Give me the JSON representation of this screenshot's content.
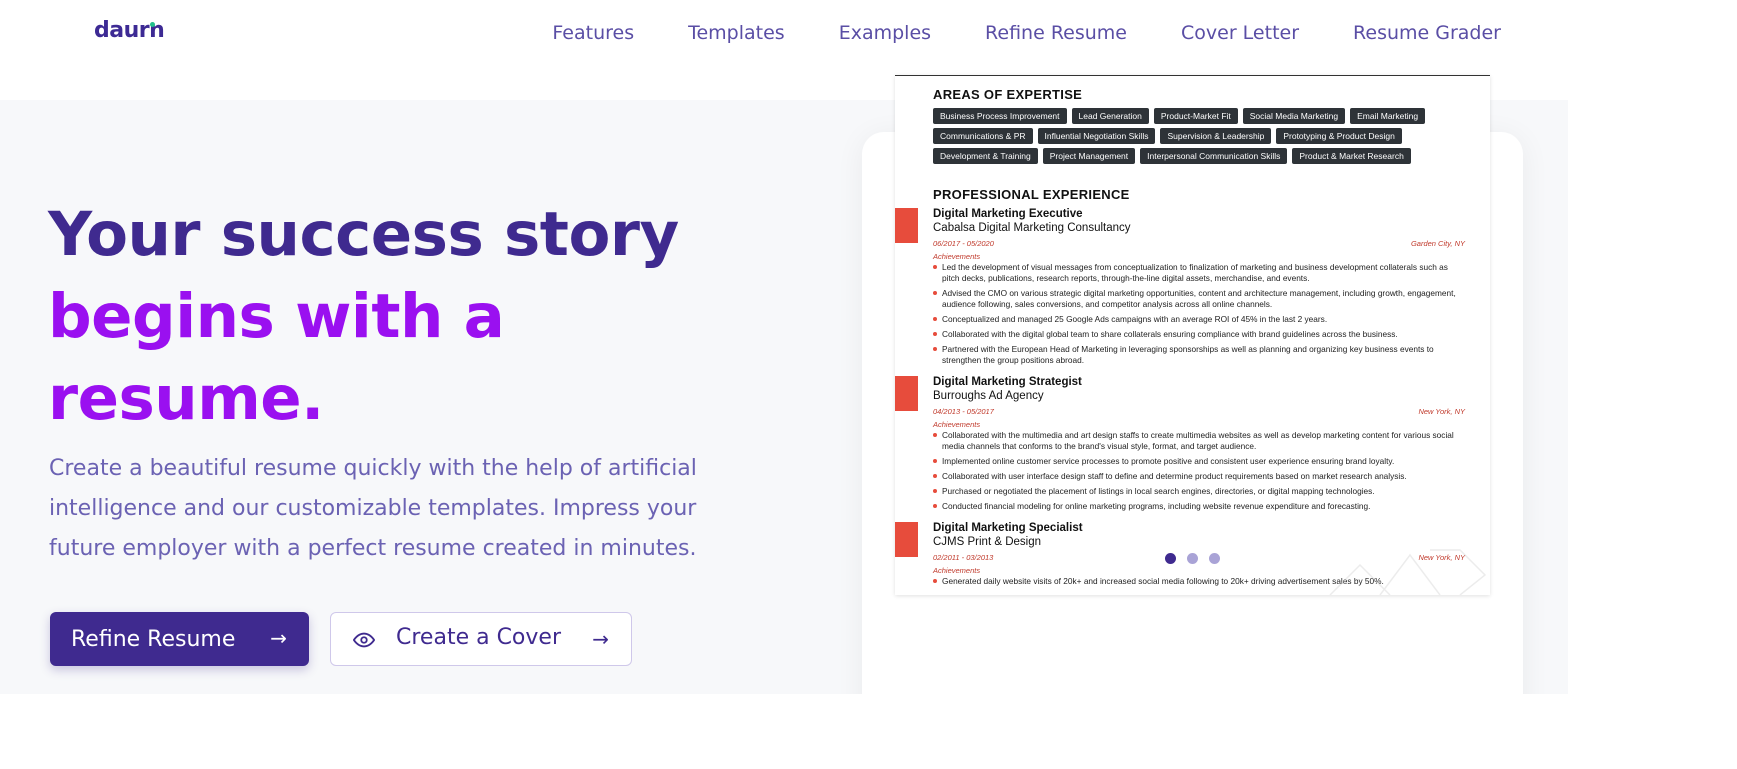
{
  "header": {
    "logo_text": "daurn",
    "nav": [
      {
        "label": "Features"
      },
      {
        "label": "Templates"
      },
      {
        "label": "Examples"
      },
      {
        "label": "Refine Resume"
      },
      {
        "label": "Cover Letter"
      },
      {
        "label": "Resume Grader"
      }
    ]
  },
  "hero": {
    "headline_line1": "Your success story",
    "headline_line2": "begins with a",
    "headline_line3": "resume.",
    "subtext": "Create a beautiful resume quickly with the help of artificial intelligence and our customizable templates. Impress your future employer with a perfect resume created in minutes.",
    "primary_button": "Refine Resume",
    "secondary_button": "Create a Cover"
  },
  "colors": {
    "brand_dark": "#3f2a8f",
    "brand_purple": "#9a10f0",
    "accent_red": "#e74c3c"
  },
  "resume": {
    "expertise_title": "AREAS OF EXPERTISE",
    "tags": [
      "Business Process Improvement",
      "Lead Generation",
      "Product-Market Fit",
      "Social Media Marketing",
      "Email Marketing",
      "Communications & PR",
      "Influential Negotiation Skills",
      "Supervision & Leadership",
      "Prototyping & Product Design",
      "Development & Training",
      "Project Management",
      "Interpersonal Communication Skills",
      "Product & Market Research"
    ],
    "experience_title": "PROFESSIONAL EXPERIENCE",
    "jobs": [
      {
        "title": "Digital Marketing Executive",
        "company": "Cabalsa Digital Marketing Consultancy",
        "dates": "06/2017 - 05/2020",
        "location": "Garden City, NY",
        "achievements_label": "Achievements",
        "bullets": [
          "Led the development of visual messages from conceptualization to finalization of marketing and business development collaterals such as pitch decks, publications, research reports, through-the-line digital assets, merchandise, and events.",
          "Advised the CMO on various strategic digital marketing opportunities, content and architecture management, including growth, engagement, audience following, sales conversions, and competitor analysis across all online channels.",
          "Conceptualized and managed 25 Google Ads campaigns with an average ROI of 45% in the last 2 years.",
          "Collaborated with the digital global team to share collaterals ensuring compliance with brand guidelines across the business.",
          "Partnered with the European Head of Marketing in leveraging sponsorships as well as planning and organizing key business events to strengthen the group positions abroad."
        ]
      },
      {
        "title": "Digital Marketing Strategist",
        "company": "Burroughs Ad Agency",
        "dates": "04/2013 - 05/2017",
        "location": "New York, NY",
        "achievements_label": "Achievements",
        "bullets": [
          "Collaborated with the multimedia and art design staffs to create multimedia websites as well as develop marketing content for various social media channels that conforms to the brand's visual style, format, and target audience.",
          "Implemented online customer service processes to promote positive and consistent user experience ensuring brand loyalty.",
          "Collaborated with user interface design staff to define and determine product requirements based on market research analysis.",
          "Purchased or negotiated the placement of listings in local search engines, directories, or digital mapping technologies.",
          "Conducted financial modeling for online marketing programs, including website revenue expenditure and forecasting."
        ]
      },
      {
        "title": "Digital Marketing Specialist",
        "company": "CJMS Print & Design",
        "dates": "02/2011 - 03/2013",
        "location": "New York, NY",
        "achievements_label": "Achievements",
        "bullets": [
          "Generated daily website visits of 20k+ and increased social media following to 20k+ driving advertisement sales by 50%."
        ]
      }
    ]
  }
}
